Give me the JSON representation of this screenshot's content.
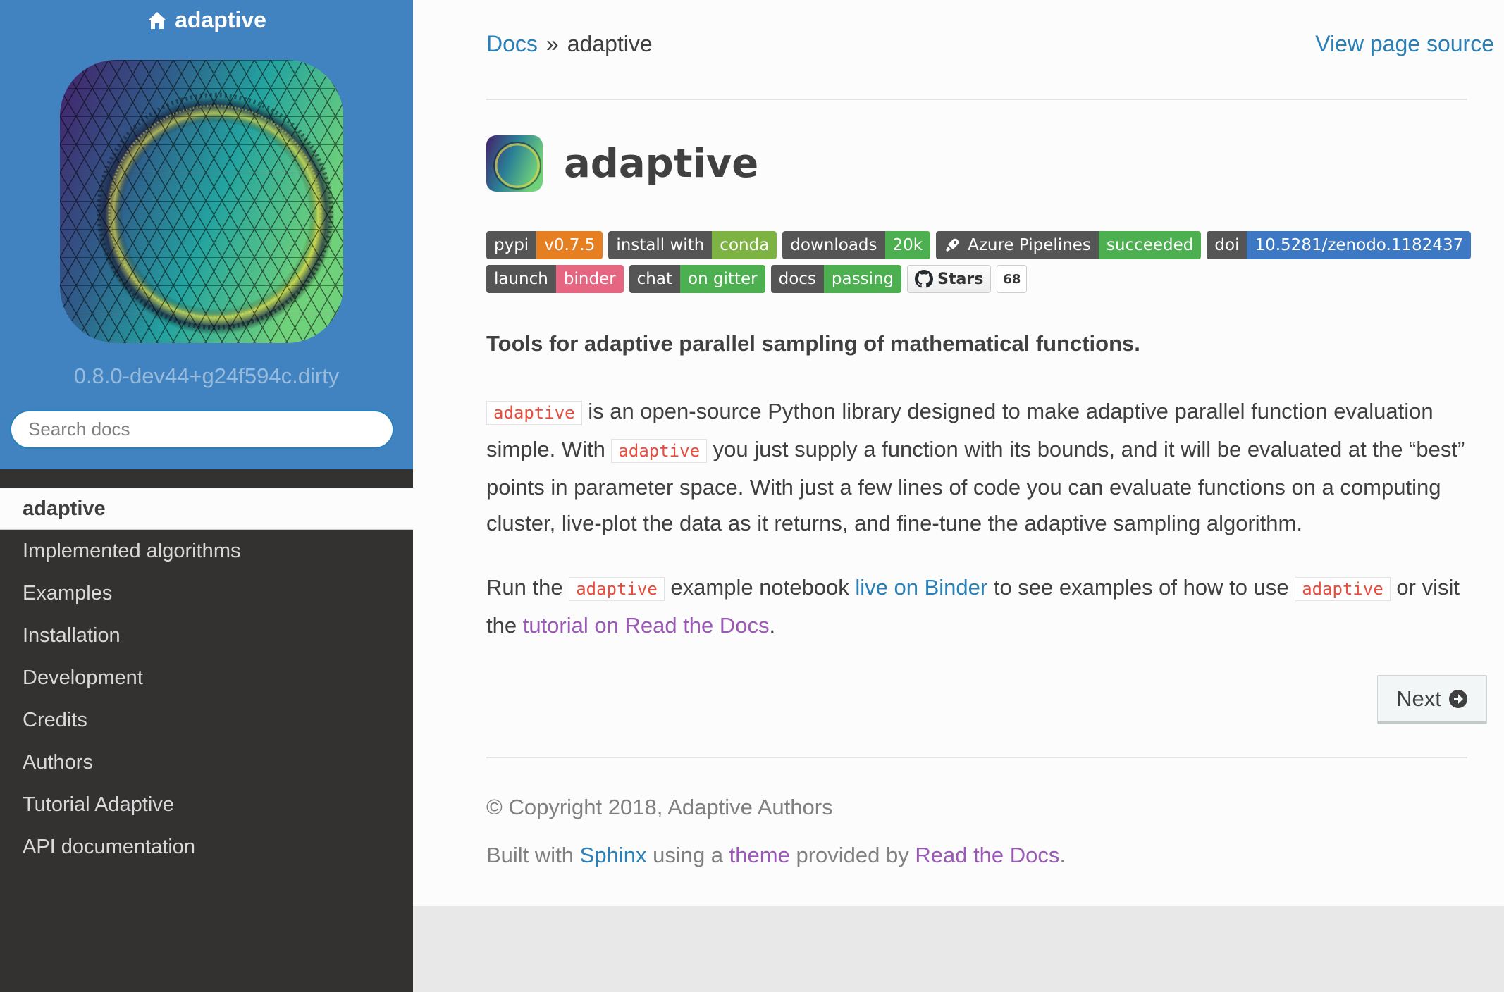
{
  "sidebar": {
    "project_name": "adaptive",
    "version": "0.8.0-dev44+g24f594c.dirty",
    "search_placeholder": "Search docs",
    "nav_items": [
      {
        "label": "adaptive"
      },
      {
        "label": "Implemented algorithms"
      },
      {
        "label": "Examples"
      },
      {
        "label": "Installation"
      },
      {
        "label": "Development"
      },
      {
        "label": "Credits"
      },
      {
        "label": "Authors"
      },
      {
        "label": "Tutorial Adaptive"
      },
      {
        "label": "API documentation"
      }
    ]
  },
  "breadcrumb": {
    "root": "Docs",
    "separator": "»",
    "current": "adaptive",
    "view_source": "View page source"
  },
  "page": {
    "title": "adaptive",
    "tagline": "Tools for adaptive parallel sampling of mathematical functions."
  },
  "badges": [
    {
      "left": "pypi",
      "right": "v0.7.5",
      "color": "#e67e22"
    },
    {
      "left": "install with",
      "right": "conda",
      "color": "#7cb342"
    },
    {
      "left": "downloads",
      "right": "20k",
      "color": "#4caf50"
    },
    {
      "left": "Azure Pipelines",
      "right": "succeeded",
      "color": "#4caf50",
      "icon": "rocket-icon"
    },
    {
      "left": "doi",
      "right": "10.5281/zenodo.1182437",
      "color": "#3c78c3"
    },
    {
      "left": "launch",
      "right": "binder",
      "color": "#e66581"
    },
    {
      "left": "chat",
      "right": "on gitter",
      "color": "#4caf50"
    },
    {
      "left": "docs",
      "right": "passing",
      "color": "#4caf50"
    }
  ],
  "github": {
    "label": "Stars",
    "count": "68",
    "icon": "github-icon"
  },
  "paragraph1": {
    "code1": "adaptive",
    "text1": " is an open-source Python library designed to make adaptive parallel function evaluation simple. With ",
    "code2": "adaptive",
    "text2": " you just supply a function with its bounds, and it will be evaluated at the “best” points in parameter space. With just a few lines of code you can evaluate functions on a computing cluster, live-plot the data as it returns, and fine-tune the adaptive sampling algorithm."
  },
  "paragraph2": {
    "t1": "Run the ",
    "code1": "adaptive",
    "t2": " example notebook ",
    "link1": "live on Binder",
    "t3": " to see examples of how to use ",
    "code2": "adaptive",
    "t4": " or visit the ",
    "link2": "tutorial on Read the Docs",
    "t5": "."
  },
  "next_button": "Next",
  "footer": {
    "copyright": "© Copyright 2018, Adaptive Authors",
    "built_with": "Built with ",
    "sphinx": "Sphinx",
    "using_a": " using a ",
    "theme": "theme",
    "provided_by": " provided by ",
    "rtd": "Read the Docs",
    "end": "."
  },
  "colors": {
    "sidebar_top": "#4183c0",
    "sidebar_bg": "#343131",
    "link": "#2980b9",
    "visited_link": "#9b59b6",
    "code": "#e74c3c"
  }
}
